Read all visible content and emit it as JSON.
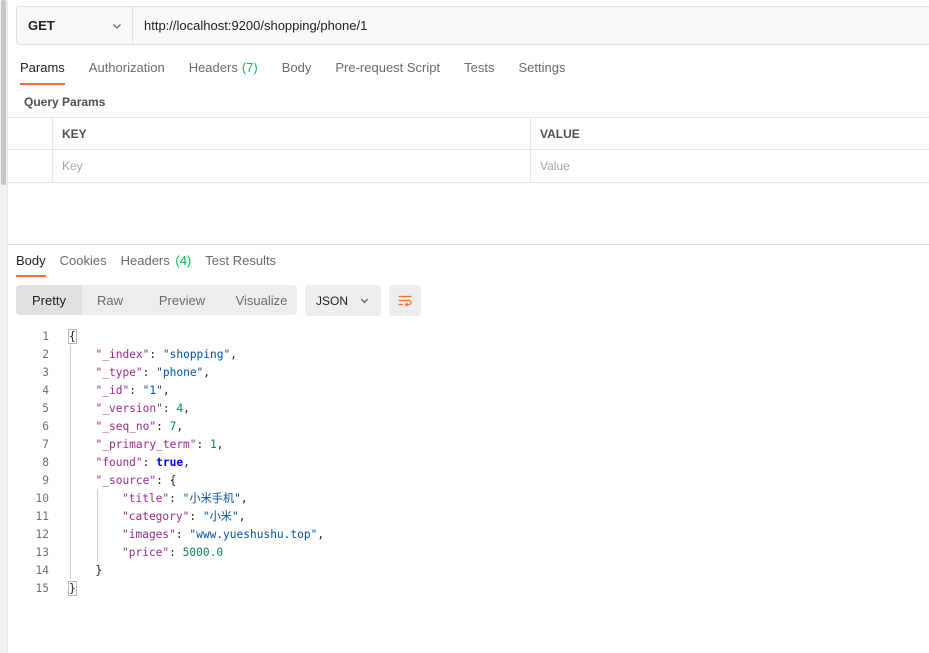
{
  "request": {
    "method": "GET",
    "url": "http://localhost:9200/shopping/phone/1"
  },
  "request_tabs": [
    {
      "label": "Params",
      "count": null,
      "active": true
    },
    {
      "label": "Authorization",
      "count": null
    },
    {
      "label": "Headers",
      "count": "(7)"
    },
    {
      "label": "Body",
      "count": null
    },
    {
      "label": "Pre-request Script",
      "count": null
    },
    {
      "label": "Tests",
      "count": null
    },
    {
      "label": "Settings",
      "count": null
    }
  ],
  "query_params": {
    "title": "Query Params",
    "columns": {
      "key": "KEY",
      "value": "VALUE"
    },
    "placeholders": {
      "key": "Key",
      "value": "Value"
    }
  },
  "response_tabs": [
    {
      "label": "Body",
      "count": null,
      "active": true
    },
    {
      "label": "Cookies",
      "count": null
    },
    {
      "label": "Headers",
      "count": "(4)"
    },
    {
      "label": "Test Results",
      "count": null
    }
  ],
  "view_modes": [
    "Pretty",
    "Raw",
    "Preview",
    "Visualize"
  ],
  "format": "JSON",
  "colors": {
    "accent": "#f26b3a",
    "count": "#0cbb52",
    "key": "#9b2b8f",
    "string": "#0451a5",
    "number": "#098658",
    "boolean": "#0000ff"
  },
  "response_body": {
    "lines": [
      {
        "n": "1",
        "indent": 0,
        "parts": [
          {
            "t": "{",
            "c": "p",
            "box": true
          }
        ]
      },
      {
        "n": "2",
        "indent": 1,
        "parts": [
          {
            "t": "\"_index\"",
            "c": "k"
          },
          {
            "t": ": ",
            "c": "p"
          },
          {
            "t": "\"shopping\"",
            "c": "s"
          },
          {
            "t": ",",
            "c": "p"
          }
        ]
      },
      {
        "n": "3",
        "indent": 1,
        "parts": [
          {
            "t": "\"_type\"",
            "c": "k"
          },
          {
            "t": ": ",
            "c": "p"
          },
          {
            "t": "\"phone\"",
            "c": "s"
          },
          {
            "t": ",",
            "c": "p"
          }
        ]
      },
      {
        "n": "4",
        "indent": 1,
        "parts": [
          {
            "t": "\"_id\"",
            "c": "k"
          },
          {
            "t": ": ",
            "c": "p"
          },
          {
            "t": "\"1\"",
            "c": "s"
          },
          {
            "t": ",",
            "c": "p"
          }
        ]
      },
      {
        "n": "5",
        "indent": 1,
        "parts": [
          {
            "t": "\"_version\"",
            "c": "k"
          },
          {
            "t": ": ",
            "c": "p"
          },
          {
            "t": "4",
            "c": "n"
          },
          {
            "t": ",",
            "c": "p"
          }
        ]
      },
      {
        "n": "6",
        "indent": 1,
        "parts": [
          {
            "t": "\"_seq_no\"",
            "c": "k"
          },
          {
            "t": ": ",
            "c": "p"
          },
          {
            "t": "7",
            "c": "n"
          },
          {
            "t": ",",
            "c": "p"
          }
        ]
      },
      {
        "n": "7",
        "indent": 1,
        "parts": [
          {
            "t": "\"_primary_term\"",
            "c": "k"
          },
          {
            "t": ": ",
            "c": "p"
          },
          {
            "t": "1",
            "c": "n"
          },
          {
            "t": ",",
            "c": "p"
          }
        ]
      },
      {
        "n": "8",
        "indent": 1,
        "parts": [
          {
            "t": "\"found\"",
            "c": "k"
          },
          {
            "t": ": ",
            "c": "p"
          },
          {
            "t": "true",
            "c": "b"
          },
          {
            "t": ",",
            "c": "p"
          }
        ]
      },
      {
        "n": "9",
        "indent": 1,
        "parts": [
          {
            "t": "\"_source\"",
            "c": "k"
          },
          {
            "t": ": {",
            "c": "p"
          }
        ]
      },
      {
        "n": "10",
        "indent": 2,
        "parts": [
          {
            "t": "\"title\"",
            "c": "k"
          },
          {
            "t": ": ",
            "c": "p"
          },
          {
            "t": "\"小米手机\"",
            "c": "s"
          },
          {
            "t": ",",
            "c": "p"
          }
        ]
      },
      {
        "n": "11",
        "indent": 2,
        "parts": [
          {
            "t": "\"category\"",
            "c": "k"
          },
          {
            "t": ": ",
            "c": "p"
          },
          {
            "t": "\"小米\"",
            "c": "s"
          },
          {
            "t": ",",
            "c": "p"
          }
        ]
      },
      {
        "n": "12",
        "indent": 2,
        "parts": [
          {
            "t": "\"images\"",
            "c": "k"
          },
          {
            "t": ": ",
            "c": "p"
          },
          {
            "t": "\"www.yueshushu.top\"",
            "c": "s"
          },
          {
            "t": ",",
            "c": "p"
          }
        ]
      },
      {
        "n": "13",
        "indent": 2,
        "parts": [
          {
            "t": "\"price\"",
            "c": "k"
          },
          {
            "t": ": ",
            "c": "p"
          },
          {
            "t": "5000.0",
            "c": "n"
          }
        ]
      },
      {
        "n": "14",
        "indent": 1,
        "parts": [
          {
            "t": "}",
            "c": "p"
          }
        ]
      },
      {
        "n": "15",
        "indent": 0,
        "parts": [
          {
            "t": "}",
            "c": "p",
            "box": true
          }
        ]
      }
    ]
  }
}
